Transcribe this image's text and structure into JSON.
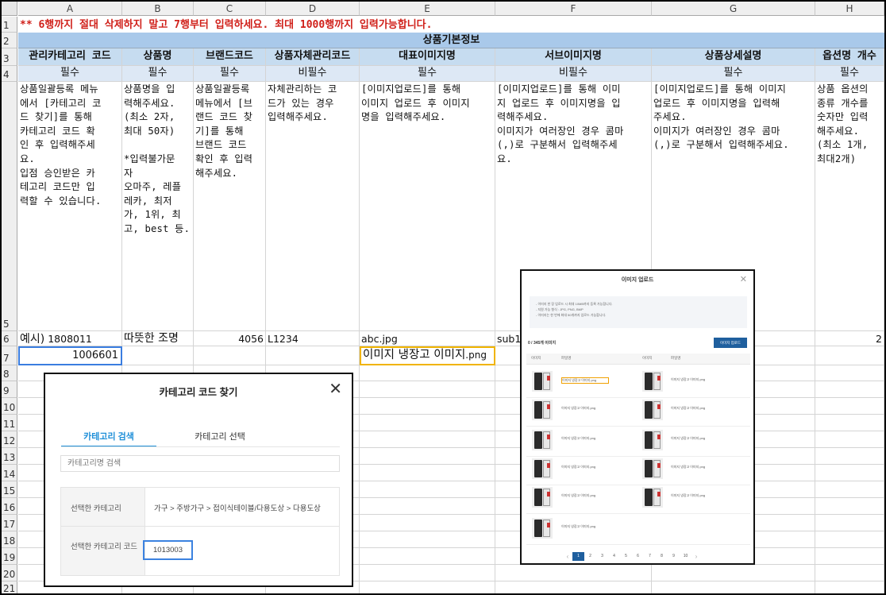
{
  "columns": [
    "A",
    "B",
    "C",
    "D",
    "E",
    "F",
    "G",
    "H"
  ],
  "rows": [
    "1",
    "2",
    "3",
    "4",
    "5",
    "6",
    "7",
    "8",
    "9",
    "10",
    "11",
    "12",
    "13",
    "14",
    "15",
    "16",
    "17",
    "18",
    "19",
    "20",
    "21"
  ],
  "notice": "** 6행까지 절대 삭제하지 말고 7행부터 입력하세요. 최대 1000행까지 입력가능합니다.",
  "section_title": "상품기본정보",
  "headers": [
    "관리카테고리 코드",
    "상품명",
    "브랜드코드",
    "상품자체관리코드",
    "대표이미지명",
    "서브이미지명",
    "상품상세설명",
    "옵션명 개수"
  ],
  "required": [
    "필수",
    "필수",
    "필수",
    "비필수",
    "필수",
    "비필수",
    "필수",
    "필수"
  ],
  "descriptions": [
    "상품일괄등록 메뉴\n에서 [카테고리 코\n드 찾기]를 통해\n카테고리 코드 확\n인 후 입력해주세\n요.\n입점 승인받은 카\n테고리 코드만 입\n력할 수 있습니다.",
    "상품명을 입\n력해주세요.\n(최소 2자,\n최대 50자)\n\n*입력불가문\n자\n오마주, 레플\n레카, 최저\n가, 1위, 최\n고, best 등.",
    "상품일괄등록\n메뉴에서 [브\n랜드 코드 찾\n기]를 통해\n브랜드 코드\n확인 후 입력\n해주세요.",
    "자체관리하는 코\n드가 있는 경우\n입력해주세요.",
    "[이미지업로드]를 통해\n이미지 업로드 후 이미지\n명을 입력해주세요.",
    "[이미지업로드]를 통해 이미\n지 업로드 후 이미지명을 입\n력해주세요.\n이미지가 여러장인 경우 콤마\n(,)로 구분해서 입력해주세\n요.",
    "[이미지업로드]를 통해 이미지\n업로드 후 이미지명을 입력해\n주세요.\n이미지가 여러장인 경우 콤마\n(,)로 구분해서 입력해주세요.",
    "상품 옵션의\n종류 개수를\n숫자만 입력\n해주세요.\n(최소 1개,\n최대2개)"
  ],
  "example": {
    "a_prefix": "예시)",
    "a_value": "1808011",
    "b": "따뜻한 조명",
    "c": "4056",
    "d": "L1234",
    "e": "abc.jpg",
    "f": "sub1",
    "h": "2"
  },
  "row7": {
    "a": "1006601",
    "e_main": "이미지 냉장고 이미지",
    "e_ext": ".png"
  },
  "category_popup": {
    "title": "카테고리 코드 찾기",
    "tab_search": "카테고리 검색",
    "tab_select": "카테고리 선택",
    "search_placeholder": "카테고리명 검색",
    "selected_label": "선택한 카테고리",
    "selected_path": "가구 > 주방가구 > 접이식테이블/다용도상 > 다용도상",
    "code_label": "선택한 카테고리 코드",
    "code_value": "1013003",
    "accent": "#1f8fd8"
  },
  "image_popup": {
    "title": "이미지 업로드",
    "notes": [
      "- 이미지 한 장 업로드 시 최대 10MB까지 등록 가능합니다.",
      "- 지원 가능 형식 : JPG, PNG, BMP",
      "- 이미지는 한 번에 최대 50개까지 업로드 가능합니다."
    ],
    "count": "0 / 345개 이미지",
    "upload_button": "이미지 업로드",
    "col_headers": [
      "이미지",
      "파일명",
      "이미지",
      "파일명"
    ],
    "left_files": [
      "이미지 냉장고 이미지.png",
      "이미지 냉장고 이미지.png",
      "이미지 냉장고 이미지.png",
      "이미지 냉장고 이미지.png",
      "이미지 냉장고 이미지.png",
      "이미지 냉장고 이미지.png"
    ],
    "right_files": [
      "이미지 냉장고 이미지.png",
      "이미지 냉장고 이미지.png",
      "이미지 냉장고 이미지.png",
      "이미지 냉장고 이미지.png",
      "이미지 냉장고 이미지.png"
    ],
    "pages": [
      "1",
      "2",
      "3",
      "4",
      "5",
      "6",
      "7",
      "8",
      "9",
      "10"
    ]
  }
}
